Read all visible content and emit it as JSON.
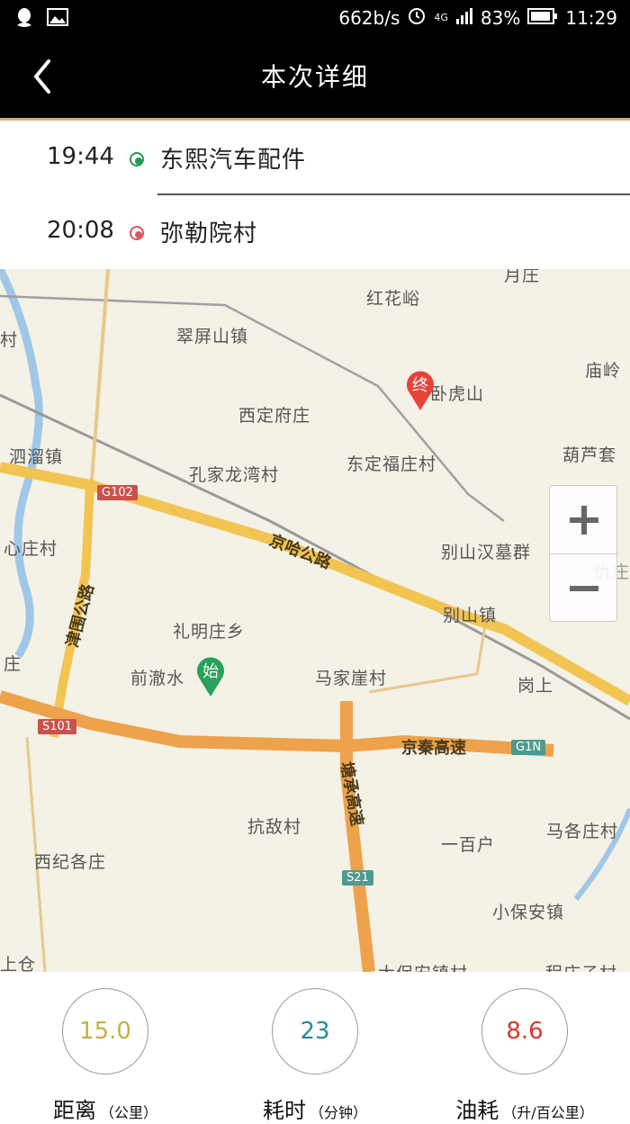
{
  "status_bar": {
    "speed": "662b/s",
    "network": "4G",
    "battery": "83%",
    "time": "11:29",
    "icons": [
      "qq-icon",
      "image-icon",
      "alarm-icon",
      "signal-icon",
      "battery-icon"
    ]
  },
  "header": {
    "title": "本次详细"
  },
  "route": {
    "start": {
      "time": "19:44",
      "place": "东熙汽车配件",
      "color": "#1e9a55"
    },
    "end": {
      "time": "20:08",
      "place": "弥勒院村",
      "color": "#e0575f"
    }
  },
  "map": {
    "labels": [
      "红花峪",
      "翠屏山镇",
      "庙岭",
      "卧虎山",
      "西定府庄",
      "泗溜镇",
      "东定福庄村",
      "葫芦套",
      "孔家龙湾村",
      "心庄村",
      "别山汉墓群",
      "仇庄",
      "礼明庄乡",
      "别山镇",
      "前澈水",
      "马家崖村",
      "岗上",
      "庄",
      "抗敌村",
      "一百户",
      "马各庄村",
      "西纪各庄",
      "小保安镇",
      "上仓",
      "村",
      "月庄",
      "大保安镇村",
      "程庄子村"
    ],
    "roads": [
      "京哈公路",
      "津围公路",
      "京秦高速",
      "塘承高速"
    ],
    "shields": [
      "G102",
      "S101",
      "G1N",
      "S21"
    ],
    "start_pin": "始",
    "end_pin": "终",
    "zoom_in": "+",
    "zoom_out": "−"
  },
  "stats": [
    {
      "value": "15.0",
      "label": "距离",
      "unit": "（公里）",
      "color": "#c8b042"
    },
    {
      "value": "23",
      "label": "耗时",
      "unit": "（分钟）",
      "color": "#2a8a9a"
    },
    {
      "value": "8.6",
      "label": "油耗",
      "unit": "（升/百公里）",
      "color": "#d43a2a"
    }
  ]
}
